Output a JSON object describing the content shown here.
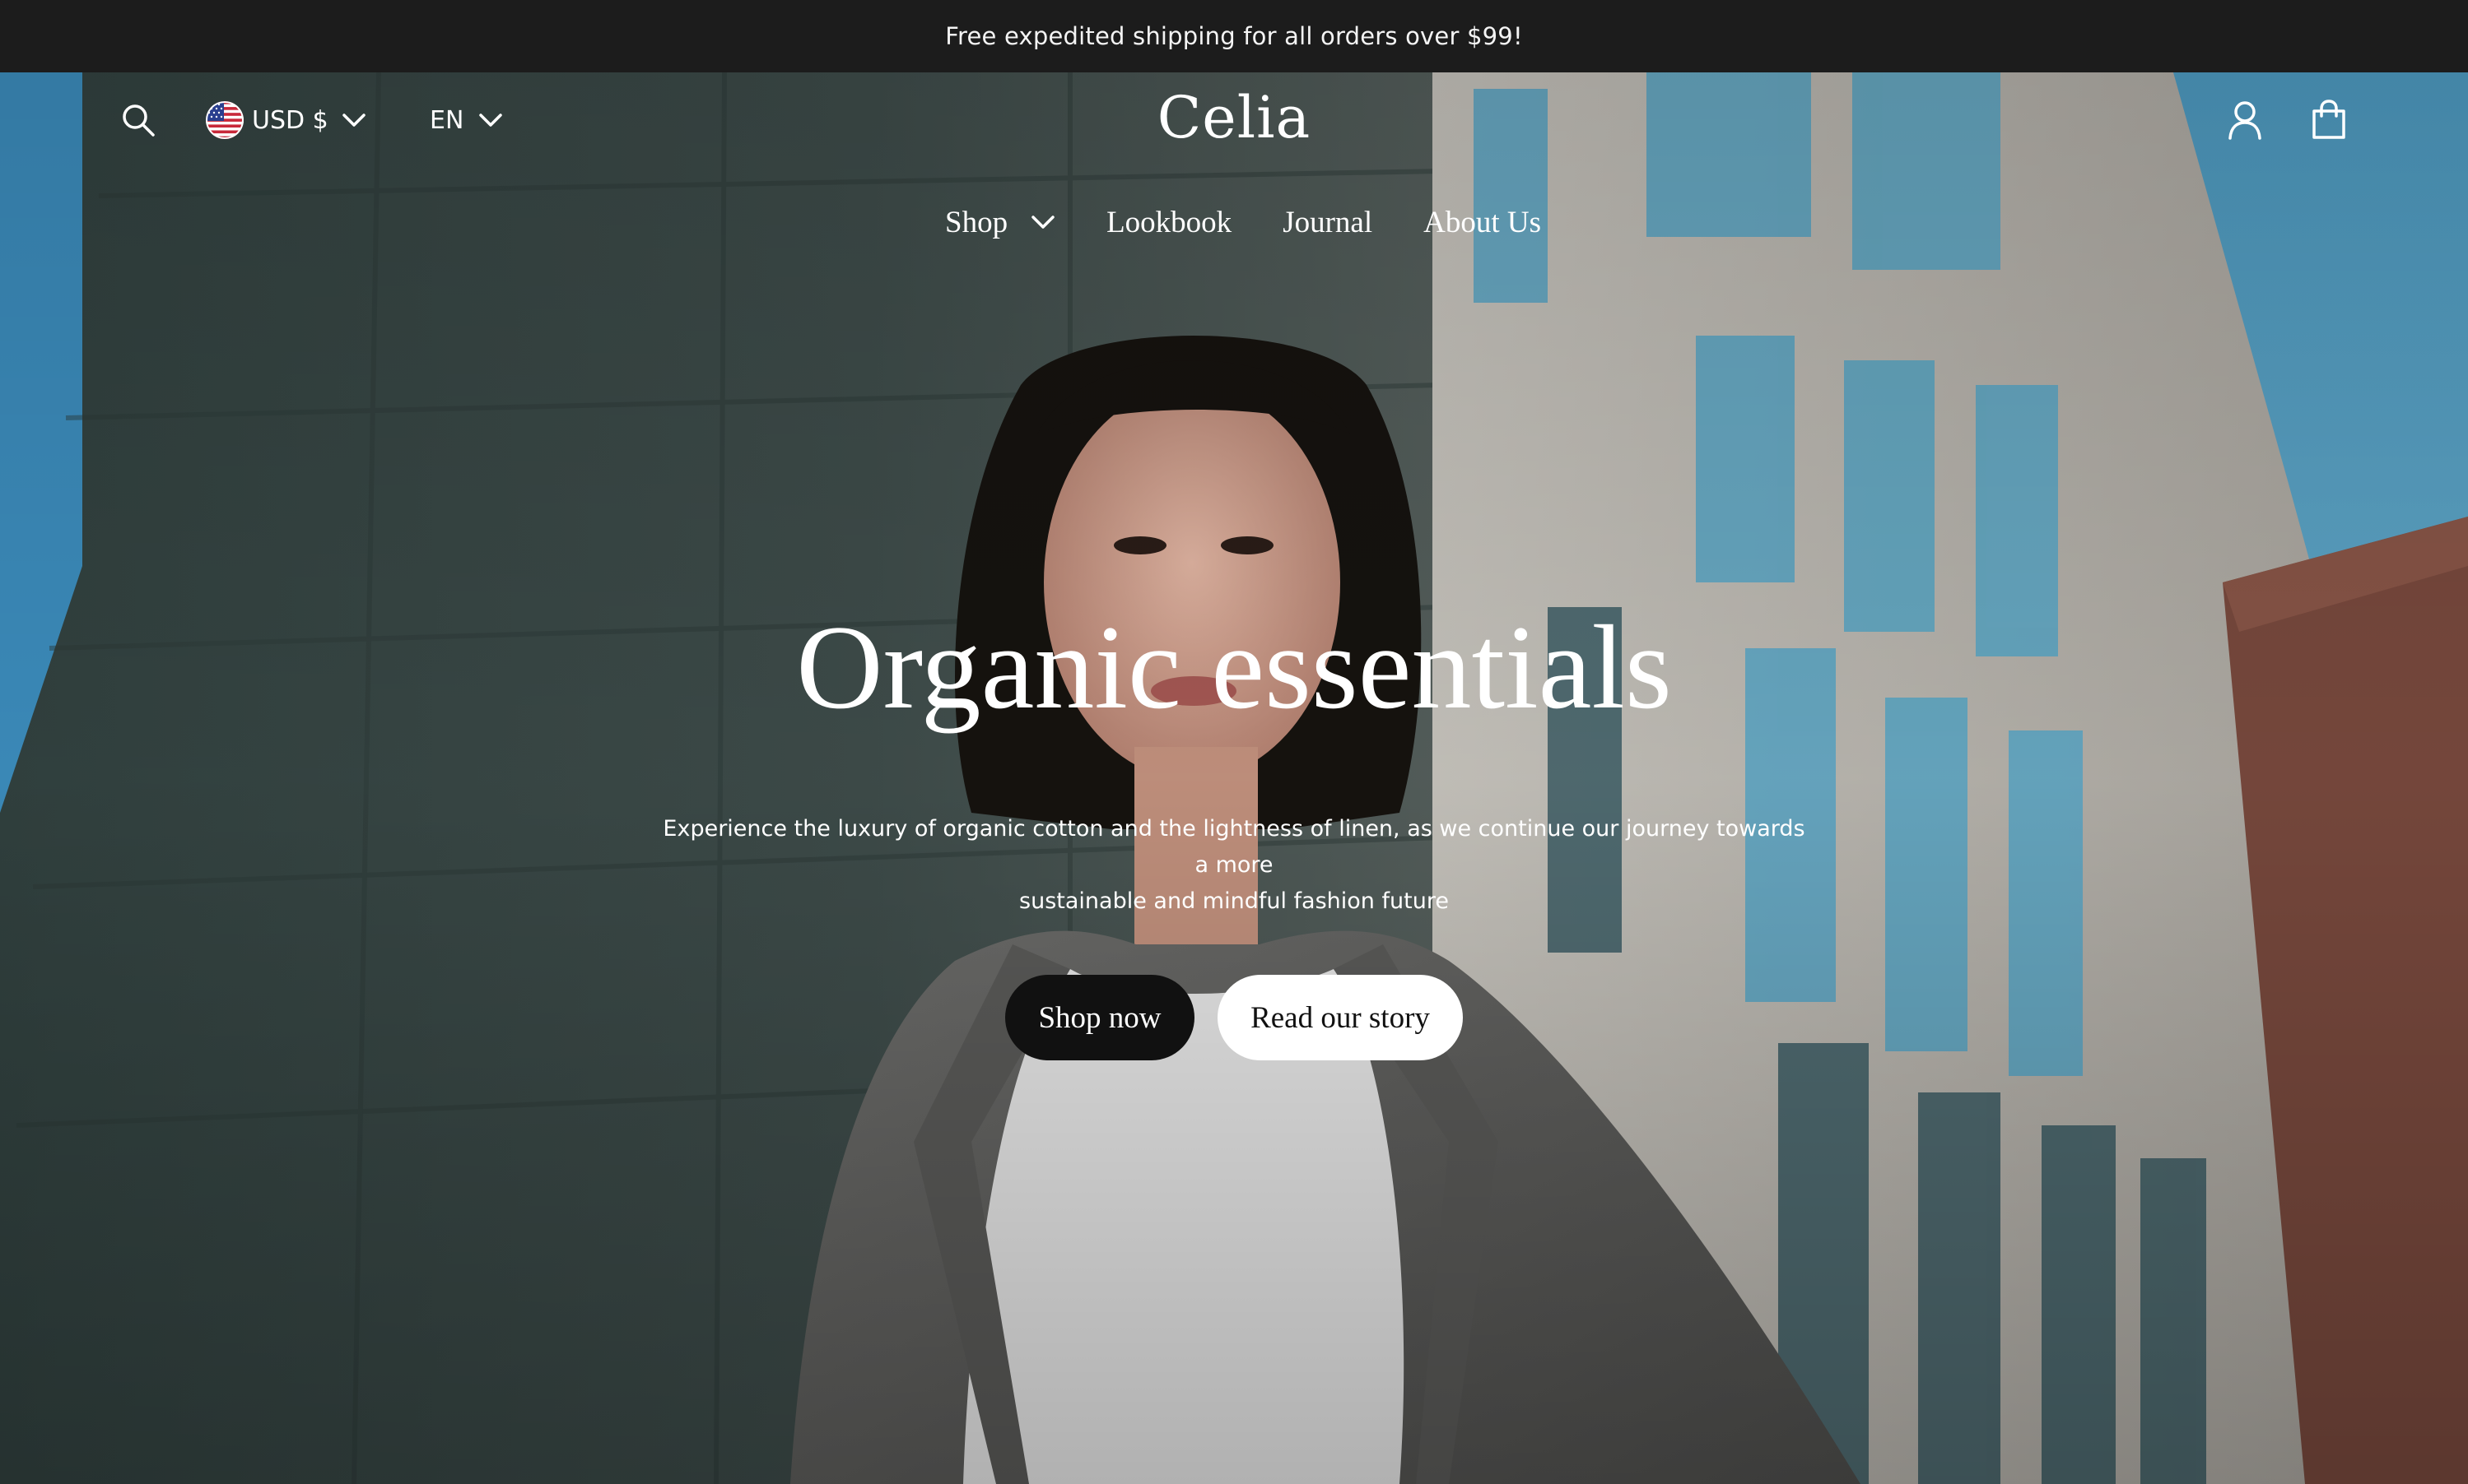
{
  "announcement": "Free expedited shipping for all orders over $99!",
  "header": {
    "currency": "USD $",
    "language": "EN",
    "logo": "Celia",
    "icons": {
      "search": "search-icon",
      "account": "user-icon",
      "cart": "shopping-bag-icon",
      "flag": "us-flag-icon"
    }
  },
  "nav": {
    "items": [
      {
        "label": "Shop"
      },
      {
        "label": "Lookbook"
      },
      {
        "label": "Journal"
      },
      {
        "label": "About Us"
      }
    ]
  },
  "hero": {
    "title": "Organic essentials",
    "subtitle_line1": "Experience the luxury of organic cotton and the lightness of linen, as we continue our journey towards a more",
    "subtitle_line2": "sustainable and mindful fashion future",
    "primary_button": "Shop now",
    "secondary_button": "Read our story"
  },
  "colors": {
    "announcement_bg": "#1c1c1c",
    "button_dark": "#111111",
    "button_light": "#ffffff",
    "sky": "#5ea5c4"
  }
}
